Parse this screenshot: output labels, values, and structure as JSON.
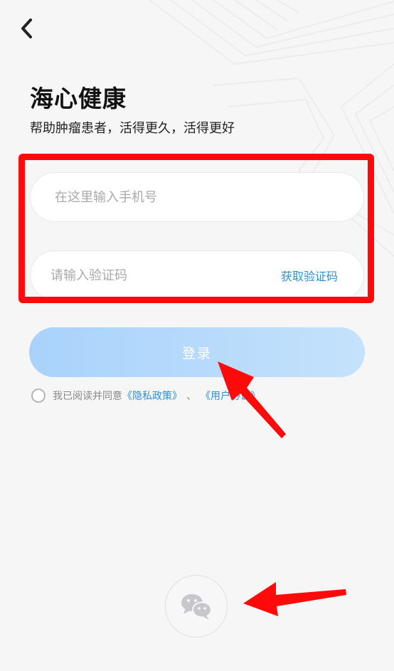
{
  "header": {
    "back_icon": "chevron-left-icon"
  },
  "brand": {
    "title": "海心健康",
    "slogan": "帮助肿瘤患者，活得更久，活得更好"
  },
  "form": {
    "phone": {
      "value": "",
      "placeholder": "在这里输入手机号"
    },
    "code": {
      "value": "",
      "placeholder": "请输入验证码",
      "get_code_label": "获取验证码"
    },
    "login_label": "登录"
  },
  "agreement": {
    "checked": false,
    "prefix": "我已阅读并同意",
    "privacy_link": "《隐私政策》",
    "separator": "、",
    "user_link": "《用户协议》"
  },
  "social": {
    "wechat_icon": "wechat-icon"
  },
  "colors": {
    "accent": "#2a8fd8",
    "login_gradient_start": "#a9d2fb",
    "login_gradient_end": "#c4e2fb",
    "annotation_red": "#ff0a0a"
  }
}
